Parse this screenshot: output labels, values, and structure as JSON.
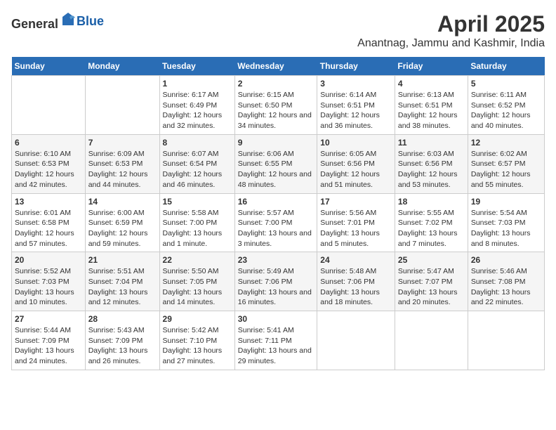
{
  "header": {
    "logo_general": "General",
    "logo_blue": "Blue",
    "title": "April 2025",
    "subtitle": "Anantnag, Jammu and Kashmir, India"
  },
  "calendar": {
    "days_of_week": [
      "Sunday",
      "Monday",
      "Tuesday",
      "Wednesday",
      "Thursday",
      "Friday",
      "Saturday"
    ],
    "weeks": [
      [
        {
          "day": "",
          "content": ""
        },
        {
          "day": "",
          "content": ""
        },
        {
          "day": "1",
          "content": "Sunrise: 6:17 AM\nSunset: 6:49 PM\nDaylight: 12 hours and 32 minutes."
        },
        {
          "day": "2",
          "content": "Sunrise: 6:15 AM\nSunset: 6:50 PM\nDaylight: 12 hours and 34 minutes."
        },
        {
          "day": "3",
          "content": "Sunrise: 6:14 AM\nSunset: 6:51 PM\nDaylight: 12 hours and 36 minutes."
        },
        {
          "day": "4",
          "content": "Sunrise: 6:13 AM\nSunset: 6:51 PM\nDaylight: 12 hours and 38 minutes."
        },
        {
          "day": "5",
          "content": "Sunrise: 6:11 AM\nSunset: 6:52 PM\nDaylight: 12 hours and 40 minutes."
        }
      ],
      [
        {
          "day": "6",
          "content": "Sunrise: 6:10 AM\nSunset: 6:53 PM\nDaylight: 12 hours and 42 minutes."
        },
        {
          "day": "7",
          "content": "Sunrise: 6:09 AM\nSunset: 6:53 PM\nDaylight: 12 hours and 44 minutes."
        },
        {
          "day": "8",
          "content": "Sunrise: 6:07 AM\nSunset: 6:54 PM\nDaylight: 12 hours and 46 minutes."
        },
        {
          "day": "9",
          "content": "Sunrise: 6:06 AM\nSunset: 6:55 PM\nDaylight: 12 hours and 48 minutes."
        },
        {
          "day": "10",
          "content": "Sunrise: 6:05 AM\nSunset: 6:56 PM\nDaylight: 12 hours and 51 minutes."
        },
        {
          "day": "11",
          "content": "Sunrise: 6:03 AM\nSunset: 6:56 PM\nDaylight: 12 hours and 53 minutes."
        },
        {
          "day": "12",
          "content": "Sunrise: 6:02 AM\nSunset: 6:57 PM\nDaylight: 12 hours and 55 minutes."
        }
      ],
      [
        {
          "day": "13",
          "content": "Sunrise: 6:01 AM\nSunset: 6:58 PM\nDaylight: 12 hours and 57 minutes."
        },
        {
          "day": "14",
          "content": "Sunrise: 6:00 AM\nSunset: 6:59 PM\nDaylight: 12 hours and 59 minutes."
        },
        {
          "day": "15",
          "content": "Sunrise: 5:58 AM\nSunset: 7:00 PM\nDaylight: 13 hours and 1 minute."
        },
        {
          "day": "16",
          "content": "Sunrise: 5:57 AM\nSunset: 7:00 PM\nDaylight: 13 hours and 3 minutes."
        },
        {
          "day": "17",
          "content": "Sunrise: 5:56 AM\nSunset: 7:01 PM\nDaylight: 13 hours and 5 minutes."
        },
        {
          "day": "18",
          "content": "Sunrise: 5:55 AM\nSunset: 7:02 PM\nDaylight: 13 hours and 7 minutes."
        },
        {
          "day": "19",
          "content": "Sunrise: 5:54 AM\nSunset: 7:03 PM\nDaylight: 13 hours and 8 minutes."
        }
      ],
      [
        {
          "day": "20",
          "content": "Sunrise: 5:52 AM\nSunset: 7:03 PM\nDaylight: 13 hours and 10 minutes."
        },
        {
          "day": "21",
          "content": "Sunrise: 5:51 AM\nSunset: 7:04 PM\nDaylight: 13 hours and 12 minutes."
        },
        {
          "day": "22",
          "content": "Sunrise: 5:50 AM\nSunset: 7:05 PM\nDaylight: 13 hours and 14 minutes."
        },
        {
          "day": "23",
          "content": "Sunrise: 5:49 AM\nSunset: 7:06 PM\nDaylight: 13 hours and 16 minutes."
        },
        {
          "day": "24",
          "content": "Sunrise: 5:48 AM\nSunset: 7:06 PM\nDaylight: 13 hours and 18 minutes."
        },
        {
          "day": "25",
          "content": "Sunrise: 5:47 AM\nSunset: 7:07 PM\nDaylight: 13 hours and 20 minutes."
        },
        {
          "day": "26",
          "content": "Sunrise: 5:46 AM\nSunset: 7:08 PM\nDaylight: 13 hours and 22 minutes."
        }
      ],
      [
        {
          "day": "27",
          "content": "Sunrise: 5:44 AM\nSunset: 7:09 PM\nDaylight: 13 hours and 24 minutes."
        },
        {
          "day": "28",
          "content": "Sunrise: 5:43 AM\nSunset: 7:09 PM\nDaylight: 13 hours and 26 minutes."
        },
        {
          "day": "29",
          "content": "Sunrise: 5:42 AM\nSunset: 7:10 PM\nDaylight: 13 hours and 27 minutes."
        },
        {
          "day": "30",
          "content": "Sunrise: 5:41 AM\nSunset: 7:11 PM\nDaylight: 13 hours and 29 minutes."
        },
        {
          "day": "",
          "content": ""
        },
        {
          "day": "",
          "content": ""
        },
        {
          "day": "",
          "content": ""
        }
      ]
    ]
  }
}
